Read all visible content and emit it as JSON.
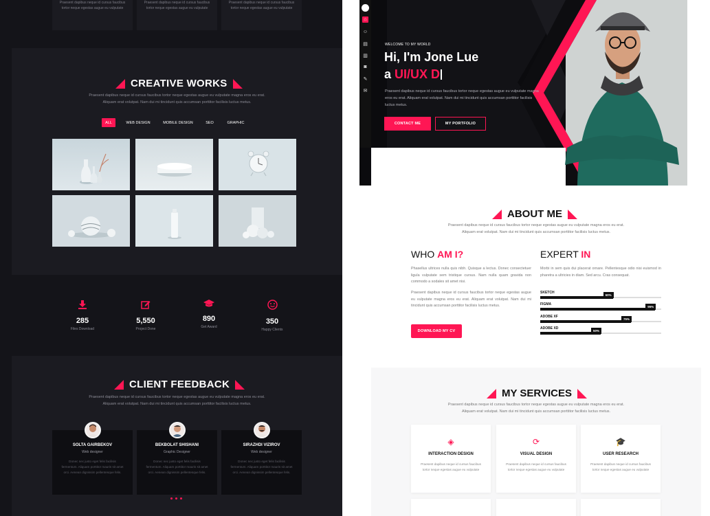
{
  "dark_page": {
    "top_cards_text": [
      "Praesent dapibus neque id cursus faucibus tortor neque egestas augue eu vulputate",
      "Praesent dapibus neque id cursus faucibus tortor neque egestas augue eu vulputate",
      "Praesent dapibus neque id cursus faucibus tortor neque egestas augue eu vulputate"
    ],
    "creative_works": {
      "title": "CREATIVE WORKS",
      "description_1": "Praesent dapibus neque id cursus faucibus tortor neque egestas augue eu vulputate magna eros eu erat.",
      "description_2": "Aliquam erat volutpat. Nam dui mi tincidunt quis accumsan porttitor facilisis luctus metus.",
      "filters": [
        "ALL",
        "WEB DESIGN",
        "MOBILE DESIGN",
        "SEO",
        "GRAPHIC"
      ],
      "active_filter": "ALL"
    },
    "stats": [
      {
        "icon": "download-icon",
        "value": "285",
        "label": "Files Download"
      },
      {
        "icon": "edit-icon",
        "value": "5,550",
        "label": "Project Done"
      },
      {
        "icon": "graduation-cap-icon",
        "value": "890",
        "label": "Get Award"
      },
      {
        "icon": "smile-icon",
        "value": "350",
        "label": "Happy Clients"
      }
    ],
    "client_feedback": {
      "title": "CLIENT FEEDBACK",
      "description_1": "Praesent dapibus neque id cursus faucibus tortor neque egestas augue eu vulputate magna eros eu erat.",
      "description_2": "Aliquam erat volutpat. Nam dui mi tincidunt quis accumsan porttitor facilisis luctus metus.",
      "clients": [
        {
          "name": "SOLTA GAIRBEKOV",
          "role": "Web designer",
          "text": "Donec nec justo eget felis facilisis fermentum. Aliquam porttitor mauris sit amet orci. Aenean dignissim pellentesque felis."
        },
        {
          "name": "BEKBOLAT SHISHANI",
          "role": "Graphic Designer",
          "text": "Donec nec justo eget felis facilisis fermentum. Aliquam porttitor mauris sit amet orci. Aenean dignissim pellentesque felis."
        },
        {
          "name": "SIRAZHDI VIZIROV",
          "role": "Web designer",
          "text": "Donec nec justo eget felis facilisis fermentum. Aliquam porttitor mauris sit amet orci. Aenean dignissim pellentesque felis."
        }
      ]
    }
  },
  "light_page": {
    "rail_icons": [
      "home-icon",
      "user-icon",
      "briefcase-icon",
      "file-icon",
      "camera-icon",
      "edit-icon",
      "mail-icon"
    ],
    "hero": {
      "kicker": "WELCOME TO MY WORLD",
      "greeting": "Hi, I'm Jone Lue",
      "role_prefix": "a ",
      "role": "UI/UX D",
      "description": "Praesent dapibus neque id cursus faucibus tortor neque egestas augue eu vulputate magna eros eu erat. Aliquam erat volutpat. Nam dui mi tincidunt quis accumsan porttitor facilisis luctus metus.",
      "contact_button": "CONTACT ME",
      "portfolio_button": "MY PORTFOLIO"
    },
    "about": {
      "title": "ABOUT ME",
      "description_1": "Praesent dapibus neque id cursus faucibus tortor neque egestas augue eu vulputate magna eros eu erat.",
      "description_2": "Aliquam erat volutpat. Nam dui mi tincidunt quis accumsan porttitor facilisis luctus metus.",
      "who_prefix": "WHO ",
      "who_accent": "AM I?",
      "who_text_1": "Phasellus ultrices nulla quis nibh. Quisque a lectus. Donec consectetuer ligula vulputate sem tristique cursus. Nam nulla quam gravida non commodo a sodales sit amet nisi.",
      "who_text_2": "Praesent dapibus neque id cursus faucibus tortor neque egestas augue eu vulputate magna eros eu erat. Aliquam erat volutpat. Nam dui mi tincidunt quis accumsan porttitor facilisis luctus metus.",
      "download_button": "DOWNLOAD MY CV",
      "expert_prefix": "EXPERT ",
      "expert_accent": "IN",
      "expert_text": "Morbi in sem quis dui placerat ornare. Pellentesque odio nisi euismod in pharetra a ultricies in diam. Sed arcu. Cras consequat.",
      "skills": [
        {
          "name": "SKETCH",
          "value": 60,
          "label": "60%"
        },
        {
          "name": "FIGMA",
          "value": 95,
          "label": "95%"
        },
        {
          "name": "ADOBE XF",
          "value": 75,
          "label": "75%"
        },
        {
          "name": "ADOBE XD",
          "value": 50,
          "label": "50%"
        }
      ]
    },
    "services": {
      "title": "MY SERVICES",
      "description_1": "Praesent dapibus neque id cursus faucibus tortor neque egestas augue eu vulputate magna eros eu erat.",
      "description_2": "Aliquam erat volutpat. Nam dui mi tincidunt quis accumsan porttitor facilisis luctus metus.",
      "items": [
        {
          "icon": "layers-icon",
          "title": "INTERACTION DESIGN",
          "text": "Praesent dapibus neque id cursus faucibus tortor neque egestas augue eu vulputate"
        },
        {
          "icon": "refresh-icon",
          "title": "VISUAL DESIGN",
          "text": "Praesent dapibus neque id cursus faucibus tortor neque egestas augue eu vulputate"
        },
        {
          "icon": "graduation-cap-icon",
          "title": "USER RESEARCH",
          "text": "Praesent dapibus neque id cursus faucibus tortor neque egestas augue eu vulputate"
        }
      ]
    }
  },
  "colors": {
    "accent": "#ff1654",
    "dark_bg": "#141419",
    "card_dark": "#1b1b21",
    "light_bg": "#ffffff"
  }
}
